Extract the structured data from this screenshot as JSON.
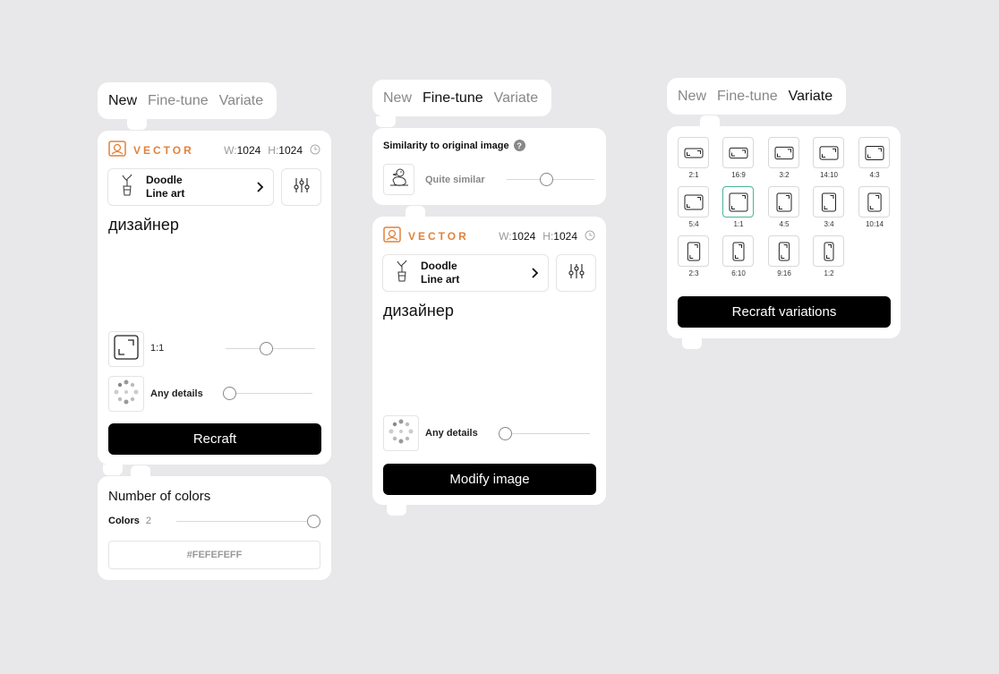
{
  "tabs": [
    "New",
    "Fine-tune",
    "Variate"
  ],
  "panel1": {
    "vector_label": "VECTOR",
    "w_label": "W:",
    "w_value": "1024",
    "h_label": "H:",
    "h_value": "1024",
    "style_line1": "Doodle",
    "style_line2": "Line art",
    "prompt": "дизайнер",
    "ratio_label": "1:1",
    "details_label": "Any details",
    "button": "Recraft",
    "slider_ratio": 0.45,
    "slider_details": 0.05
  },
  "colors_panel": {
    "title": "Number of colors",
    "colors_label": "Colors",
    "colors_value": "2",
    "hex_value": "#FEFEFEFF",
    "slider_colors": 1.0
  },
  "panel2": {
    "similarity_title": "Similarity to original image",
    "help_icon": "?",
    "similarity_value": "Quite similar",
    "slider_similarity": 0.45,
    "vector_label": "VECTOR",
    "w_label": "W:",
    "w_value": "1024",
    "h_label": "H:",
    "h_value": "1024",
    "style_line1": "Doodle",
    "style_line2": "Line art",
    "prompt": "дизайнер",
    "details_label": "Any details",
    "slider_details": 0.05,
    "button": "Modify image"
  },
  "panel3": {
    "ratios": [
      "2:1",
      "16:9",
      "3:2",
      "14:10",
      "4:3",
      "5:4",
      "1:1",
      "4:5",
      "3:4",
      "10:14",
      "2:3",
      "6:10",
      "9:16",
      "1:2"
    ],
    "selected_ratio": "1:1",
    "button": "Recraft variations"
  },
  "colors": {
    "accent": "#e2823a",
    "selected": "#4bb39b",
    "button": "#000000"
  }
}
